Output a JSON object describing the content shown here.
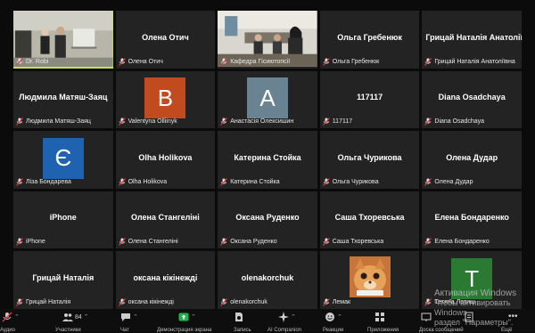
{
  "tiles": [
    {
      "label": "Dr. Robi",
      "type": "video",
      "active": true
    },
    {
      "label": "Олена Отич",
      "center": "Олена Отич",
      "type": "name"
    },
    {
      "label": "Кафедра Гісиютопсії",
      "type": "video"
    },
    {
      "label": "Ольга Гребенюк",
      "center": "Ольга Гребенюк",
      "type": "name"
    },
    {
      "label": "Грицай Наталія Анатоліївна",
      "center": "Грицай Наталія Анатоліївна",
      "type": "name"
    },
    {
      "label": "Людмила Матяш-Заяц",
      "center": "Людмила Матяш-Заяц",
      "type": "name"
    },
    {
      "label": "Valentyna Olliinyk",
      "avatar": "B",
      "avatar_color": "#c24a1f",
      "type": "avatar"
    },
    {
      "label": "Анастасія Олексишин",
      "avatar": "A",
      "avatar_color": "#6a8392",
      "type": "avatar"
    },
    {
      "label": "117117",
      "center": "117117",
      "type": "name"
    },
    {
      "label": "Diana Osadchaya",
      "center": "Diana Osadchaya",
      "type": "name"
    },
    {
      "label": "Ліза Бондарева",
      "avatar": "Є",
      "avatar_color": "#1e62b0",
      "type": "avatar"
    },
    {
      "label": "Olha Holikova",
      "center": "Olha Holikova",
      "type": "name"
    },
    {
      "label": "Катерина Стойка",
      "center": "Катерина Стойка",
      "type": "name"
    },
    {
      "label": "Ольга Чурикова",
      "center": "Ольга Чурикова",
      "type": "name"
    },
    {
      "label": "Олена Дудар",
      "center": "Олена Дудар",
      "type": "name"
    },
    {
      "label": "iPhone",
      "center": "iPhone",
      "type": "name"
    },
    {
      "label": "Олена Стангеліні",
      "center": "Олена Стангеліні",
      "type": "name"
    },
    {
      "label": "Оксана Руденко",
      "center": "Оксана Руденко",
      "type": "name"
    },
    {
      "label": "Саша Тхоревська",
      "center": "Саша Тхоревська",
      "type": "name"
    },
    {
      "label": "Елена Бондаренко",
      "center": "Елена  Бондаренко",
      "type": "name"
    },
    {
      "label": "Грицай Наталія",
      "center": "Грицай Наталія",
      "type": "name"
    },
    {
      "label": "оксана кікінежді",
      "center": "оксана кікінежді",
      "type": "name"
    },
    {
      "label": "olenakorchuk",
      "center": "olenakorchuk",
      "type": "name"
    },
    {
      "label": "Лемак",
      "type": "image"
    },
    {
      "label": "Тетяна Лотиш",
      "avatar": "T",
      "avatar_color": "#2a7a34",
      "type": "avatar"
    }
  ],
  "toolbar": {
    "participants_count": "84",
    "items": [
      "Аудио",
      "Участники",
      "Чат",
      "Демонстрация экрана",
      "Запись",
      "AI Companion",
      "Реакции",
      "Приложения",
      "Доска сообщений",
      "Ещё"
    ]
  },
  "watermark": {
    "line1": "Активация Windows",
    "line2": "Чтобы активировать Windows",
    "line3": "раздел \"Параметры\"."
  }
}
